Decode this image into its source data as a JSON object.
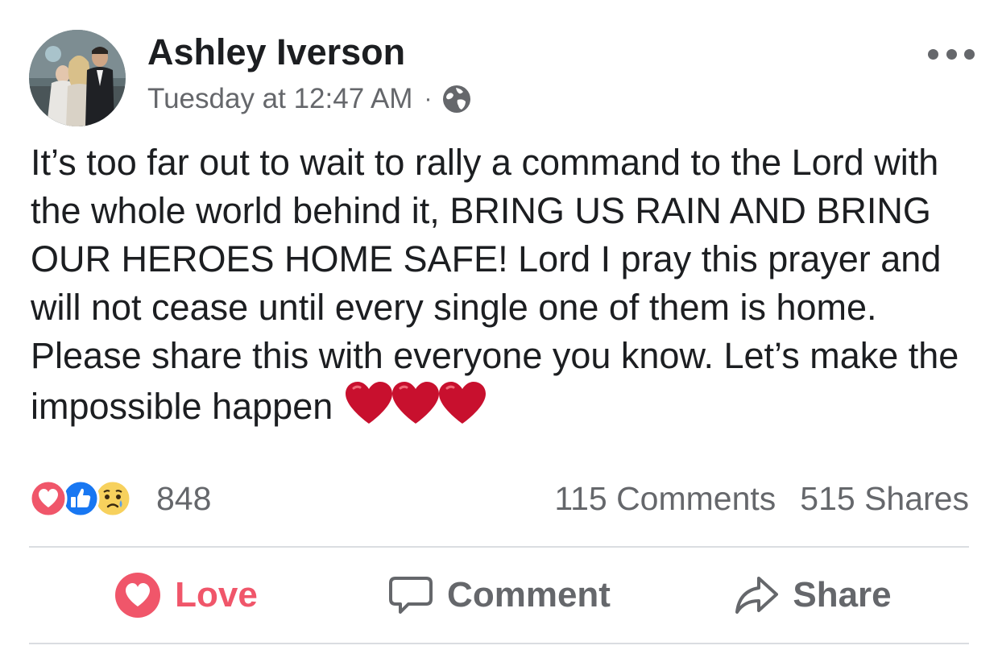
{
  "post": {
    "author": "Ashley Iverson",
    "timestamp": "Tuesday at 12:47 AM",
    "separator": "·",
    "privacy_icon": "globe-icon",
    "more_icon": "more-options-icon",
    "text": "It’s too far out to wait to rally a command to the Lord with the whole world behind it, BRING US RAIN AND BRING OUR HEROES HOME SAFE! Lord I pray this prayer and will not cease until every single one of them is home. Please share this with everyone you know. Let’s make the impossible happen",
    "emoji": [
      "red-heart",
      "red-heart",
      "red-heart"
    ]
  },
  "reactions": {
    "icons": [
      "love-reaction-icon",
      "like-reaction-icon",
      "sad-reaction-icon"
    ],
    "count": "848"
  },
  "stats": {
    "comments": "115 Comments",
    "shares": "515 Shares"
  },
  "actions": {
    "love_label": "Love",
    "comment_label": "Comment",
    "share_label": "Share"
  },
  "colors": {
    "love": "#f0566a",
    "like": "#1877f2",
    "sad": "#f7d15d",
    "secondary_text": "#65676b",
    "primary_text": "#1c1e21",
    "divider": "#dadde1",
    "heart_emoji": "#c8102e"
  }
}
